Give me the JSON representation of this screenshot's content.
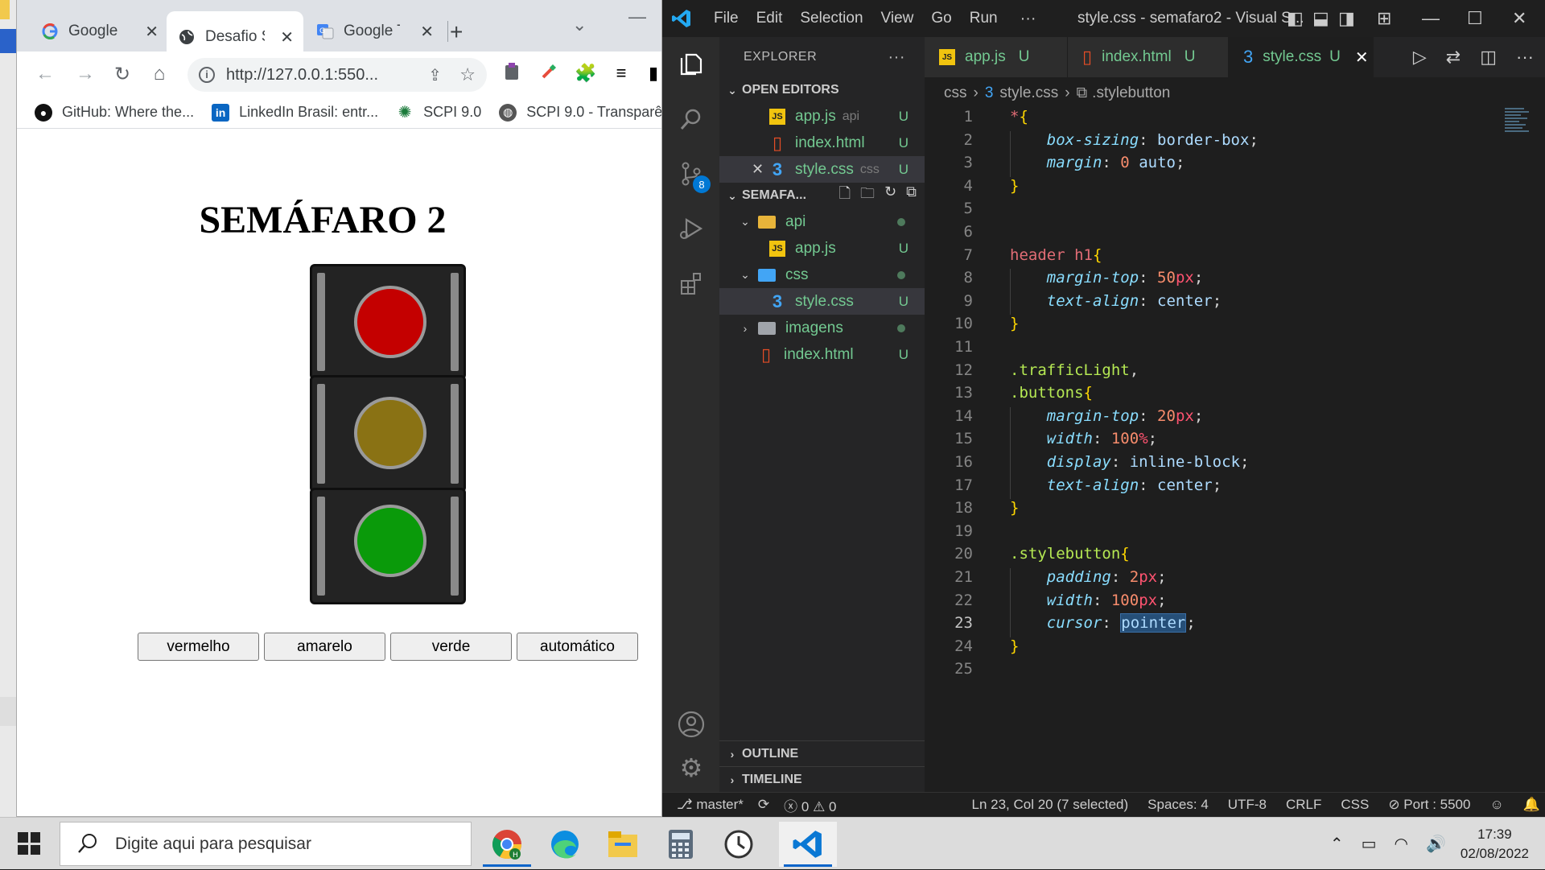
{
  "browser": {
    "tabs": [
      {
        "label": "Google",
        "active": false
      },
      {
        "label": "Desafio S",
        "active": true
      },
      {
        "label": "Google T",
        "active": false
      }
    ],
    "url": "http://127.0.0.1:550...",
    "bookmarks": [
      {
        "label": "GitHub: Where the...",
        "icon": "github-icon"
      },
      {
        "label": "LinkedIn Brasil: entr...",
        "icon": "linkedin-icon"
      },
      {
        "label": "SCPI 9.0",
        "icon": "scpi-icon"
      },
      {
        "label": "SCPI 9.0 - Transparê...",
        "icon": "globe-icon"
      }
    ],
    "page": {
      "title": "SEMÁFARO 2",
      "buttons": [
        "vermelho",
        "amarelo",
        "verde",
        "automático"
      ],
      "lights": {
        "red": "#c40000",
        "yellow": "#8a7214",
        "green": "#0a9a0a"
      }
    }
  },
  "vscode": {
    "menu": [
      "File",
      "Edit",
      "Selection",
      "View",
      "Go",
      "Run"
    ],
    "window_title": "style.css - semafaro2 - Visual S...",
    "explorer_title": "EXPLORER",
    "open_editors_label": "OPEN EDITORS",
    "open_editors": [
      {
        "name": "app.js",
        "hint": "api",
        "status": "U"
      },
      {
        "name": "index.html",
        "hint": "",
        "status": "U"
      },
      {
        "name": "style.css",
        "hint": "css",
        "status": "U"
      }
    ],
    "project_label": "SEMAFA...",
    "tree": [
      {
        "name": "api",
        "type": "folder"
      },
      {
        "name": "app.js",
        "type": "file",
        "status": "U"
      },
      {
        "name": "css",
        "type": "folder"
      },
      {
        "name": "style.css",
        "type": "file",
        "status": "U"
      },
      {
        "name": "imagens",
        "type": "folder"
      },
      {
        "name": "index.html",
        "type": "file",
        "status": "U"
      }
    ],
    "outline_label": "OUTLINE",
    "timeline_label": "TIMELINE",
    "editor_tabs": [
      {
        "name": "app.js",
        "status": "U"
      },
      {
        "name": "index.html",
        "status": "U"
      },
      {
        "name": "style.css",
        "status": "U"
      }
    ],
    "breadcrumb": [
      "css",
      "style.css",
      ".stylebutton"
    ],
    "source_control_badge": "8",
    "code_lines": [
      "*{",
      "    box-sizing: border-box;",
      "    margin: 0 auto;",
      "}",
      "",
      "",
      "header h1{",
      "    margin-top: 50px;",
      "    text-align: center;",
      "}",
      "",
      ".trafficLight,",
      ".buttons{",
      "    margin-top: 20px;",
      "    width: 100%;",
      "    display: inline-block;",
      "    text-align: center;",
      "}",
      "",
      ".stylebutton{",
      "    padding: 2px;",
      "    width: 100px;",
      "    cursor: pointer;",
      "}",
      ""
    ],
    "line_numbers": [
      "1",
      "2",
      "3",
      "4",
      "5",
      "6",
      "7",
      "8",
      "9",
      "10",
      "11",
      "12",
      "13",
      "14",
      "15",
      "16",
      "17",
      "18",
      "19",
      "20",
      "21",
      "22",
      "23",
      "24",
      "25"
    ],
    "current_line": "23",
    "status": {
      "branch": "master*",
      "errors": "0",
      "warnings": "0",
      "position": "Ln 23, Col 20 (7 selected)",
      "spaces": "Spaces: 4",
      "encoding": "UTF-8",
      "eol": "CRLF",
      "language": "CSS",
      "port": "Port : 5500"
    }
  },
  "taskbar": {
    "search_placeholder": "Digite aqui para pesquisar",
    "time": "17:39",
    "date": "02/08/2022"
  }
}
